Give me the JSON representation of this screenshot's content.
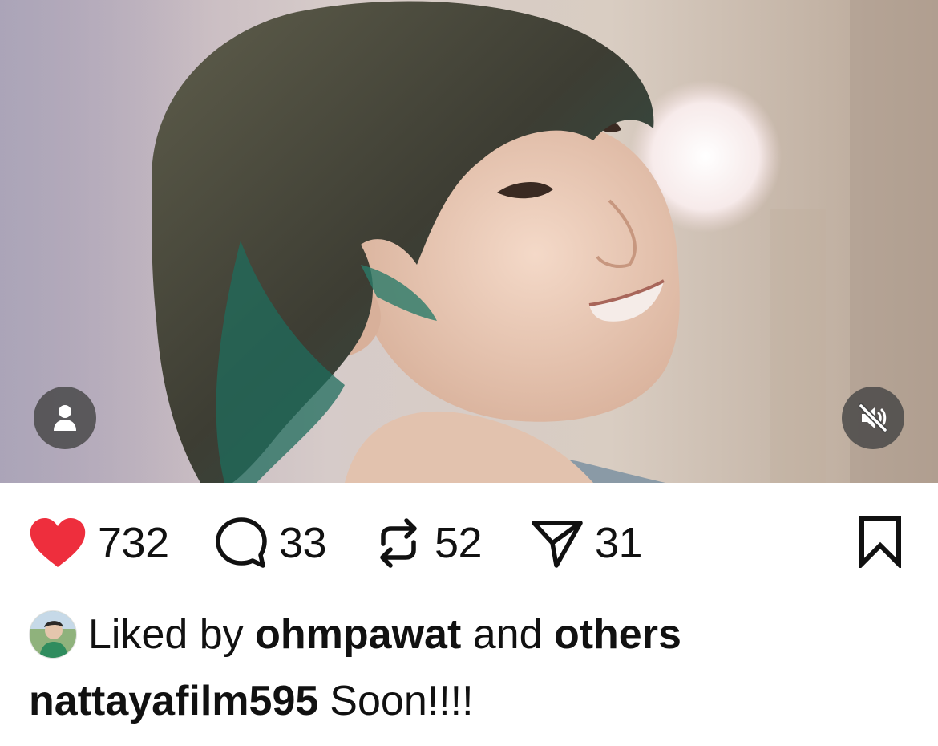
{
  "post": {
    "media": {
      "type": "video",
      "tag_icon": "person-icon",
      "mute_icon": "speaker-muted-icon"
    },
    "actions": {
      "like": {
        "icon": "heart-filled-icon",
        "count": "732",
        "color": "#ee2e3d"
      },
      "comment": {
        "icon": "speech-bubble-icon",
        "count": "33"
      },
      "repost": {
        "icon": "repost-arrows-icon",
        "count": "52"
      },
      "share": {
        "icon": "paper-plane-icon",
        "count": "31"
      },
      "bookmark": {
        "icon": "bookmark-icon"
      }
    },
    "liked_by": {
      "prefix": "Liked by",
      "user": "ohmpawat",
      "joiner": "and",
      "others": "others"
    },
    "caption": {
      "username": "nattayafilm595",
      "text": "Soon!!!!"
    }
  }
}
